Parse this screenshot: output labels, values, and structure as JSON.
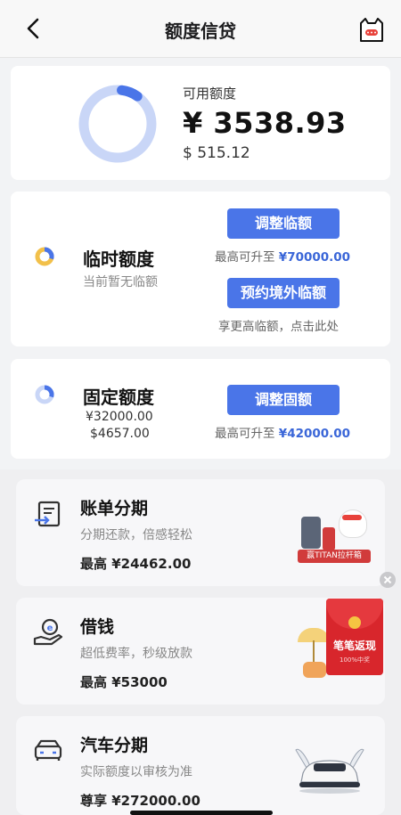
{
  "header": {
    "title": "额度信贷"
  },
  "available": {
    "label": "可用额度",
    "cny": "¥ 3538.93",
    "usd": "$ 515.12",
    "fraction": 0.08
  },
  "temporary": {
    "title": "临时额度",
    "status": "当前暂无临额",
    "adjust_button": "调整临额",
    "max_prefix": "最高可升至",
    "max_value": "¥70000.00",
    "overseas_button": "预约境外临额",
    "overseas_hint": "享更高临额，点击此处"
  },
  "fixed": {
    "title": "固定额度",
    "cny": "¥32000.00",
    "usd": "$4657.00",
    "adjust_button": "调整固额",
    "max_prefix": "最高可升至",
    "max_value": "¥42000.00"
  },
  "products": [
    {
      "title": "账单分期",
      "subtitle": "分期还款，倍感轻松",
      "max_label": "最高",
      "max_value": "¥24462.00",
      "icon": "bill-installment-icon",
      "promo": "赢TITAN拉杆箱"
    },
    {
      "title": "借钱",
      "subtitle": "超低费率，秒级放款",
      "max_label": "最高",
      "max_value": "¥53000",
      "icon": "money-hand-icon"
    },
    {
      "title": "汽车分期",
      "subtitle": "实际额度以审核为准",
      "max_label": "尊享",
      "max_value": "¥272000.00",
      "icon": "car-icon"
    }
  ],
  "red_envelope": {
    "title": "笔笔返现",
    "note": "100%中奖"
  },
  "colors": {
    "accent": "#4a75e8",
    "ring": "#c9d6f7",
    "red": "#d8262c"
  }
}
